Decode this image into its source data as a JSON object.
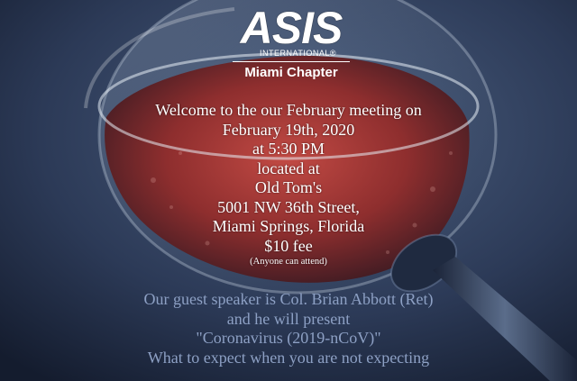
{
  "logo": {
    "brand": "ASIS",
    "subtitle": "INTERNATIONAL®",
    "chapter": "Miami Chapter"
  },
  "invite": {
    "line1": "Welcome to the our February meeting on",
    "date": "February 19th, 2020",
    "time": "at 5:30 PM",
    "located": "located at",
    "venue": "Old Tom's",
    "street": "5001 NW 36th Street,",
    "city": "Miami Springs, Florida",
    "fee": "$10 fee",
    "note": "(Anyone can attend)"
  },
  "speaker": {
    "line1": "Our guest speaker is Col. Brian Abbott (Ret)",
    "line2": "and he will present",
    "line3": "\"Coronavirus (2019-nCoV)\"",
    "line4": "What to expect when you are not expecting"
  },
  "colors": {
    "background": "#2b3a55",
    "wine": "#a83a36",
    "text": "#ffffff",
    "muted_text": "#8da0c4"
  }
}
